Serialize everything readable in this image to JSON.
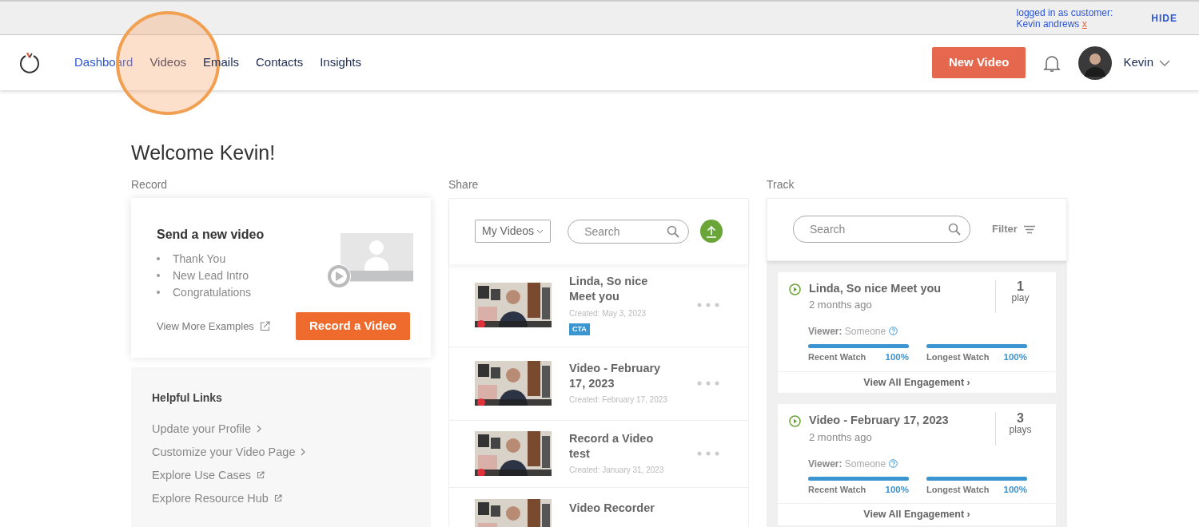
{
  "banner": {
    "login_label": "logged in as customer:",
    "login_name": "Kevin andrews",
    "remove": "x",
    "hide": "HIDE"
  },
  "nav": {
    "tabs": [
      {
        "label": "Dashboard",
        "selected": true,
        "highlighted": false
      },
      {
        "label": "Videos",
        "selected": false,
        "highlighted": true
      },
      {
        "label": "Emails",
        "selected": false,
        "highlighted": false
      },
      {
        "label": "Contacts",
        "selected": false,
        "highlighted": false
      },
      {
        "label": "Insights",
        "selected": false,
        "highlighted": false
      }
    ],
    "new_video": "New Video",
    "user": "Kevin"
  },
  "welcome": "Welcome Kevin!",
  "record": {
    "heading": "Record",
    "title": "Send a new video",
    "examples": [
      "Thank You",
      "New Lead Intro",
      "Congratulations"
    ],
    "more": "View More Examples",
    "button": "Record a Video"
  },
  "helpful_links": {
    "title": "Helpful Links",
    "links": [
      {
        "label": "Update your Profile",
        "kind": "chevron"
      },
      {
        "label": "Customize your Video Page",
        "kind": "chevron"
      },
      {
        "label": "Explore Use Cases",
        "kind": "external"
      },
      {
        "label": "Explore Resource Hub",
        "kind": "external"
      }
    ]
  },
  "share": {
    "heading": "Share",
    "filter": "My Videos",
    "search_placeholder": "Search",
    "videos": [
      {
        "title": "Linda, So nice Meet you",
        "created": "Created: May 3, 2023",
        "tag": "CTA"
      },
      {
        "title": "Video - February 17, 2023",
        "created": "Created: February 17, 2023"
      },
      {
        "title": "Record a Video test",
        "created": "Created: January 31, 2023"
      },
      {
        "title": "Video Recorder"
      }
    ]
  },
  "track": {
    "heading": "Track",
    "search_placeholder": "Search",
    "filter": "Filter",
    "items": [
      {
        "title": "Linda, So nice Meet you",
        "ago": "2 months ago",
        "count": "1",
        "count_label": "play",
        "viewer_label": "Viewer:",
        "viewer": "Someone",
        "watches": [
          {
            "label": "Recent Watch",
            "level": 1,
            "reading": "100%"
          },
          {
            "label": "Longest Watch",
            "level": 1,
            "reading": "100%"
          }
        ],
        "view_all": "View All Engagement ›"
      },
      {
        "title": "Video - February 17, 2023",
        "ago": "2 months ago",
        "count": "3",
        "count_label": "plays",
        "viewer_label": "Viewer:",
        "viewer": "Someone",
        "watches": [
          {
            "label": "Recent Watch",
            "level": 1,
            "reading": "100%"
          },
          {
            "label": "Longest Watch",
            "level": 1,
            "reading": "100%"
          }
        ],
        "view_all": "View All Engagement ›"
      }
    ]
  }
}
